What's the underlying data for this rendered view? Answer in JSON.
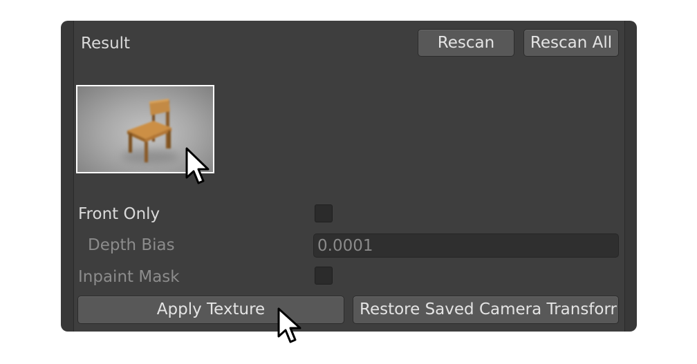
{
  "section": {
    "title": "Result"
  },
  "header": {
    "rescan_label": "Rescan",
    "rescan_all_label": "Rescan All"
  },
  "preview": {
    "icon": "chair-thumbnail"
  },
  "fields": {
    "front_only_label": "Front Only",
    "front_only_checked": false,
    "depth_bias_label": "Depth Bias",
    "depth_bias_value": "0.0001",
    "inpaint_mask_label": "Inpaint Mask",
    "inpaint_mask_checked": false
  },
  "actions": {
    "apply_texture_label": "Apply Texture",
    "restore_label": "Restore Saved Camera Transforr"
  },
  "colors": {
    "panel_bg": "#3e3e3e",
    "button_bg": "#585858",
    "text": "#dadada",
    "text_dim": "#8c8c8c",
    "selection_border": "#ffffff"
  }
}
